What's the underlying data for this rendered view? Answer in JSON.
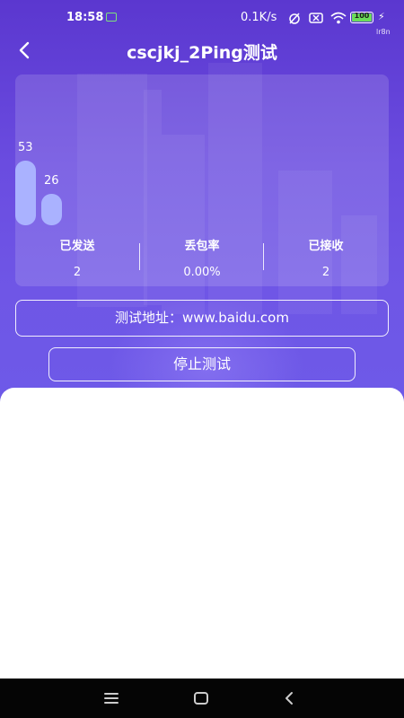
{
  "status_bar": {
    "time": "18:58",
    "net_speed": "0.1K/s",
    "battery": "100",
    "carrier_tag": "lr8n",
    "battery_level": 1.0
  },
  "header": {
    "title": "cscjkj_2Ping测试",
    "back_icon": "chevron-left-icon"
  },
  "chart_data": {
    "type": "bar",
    "values": [
      53,
      26
    ],
    "categories": [
      "",
      ""
    ]
  },
  "stats": [
    {
      "label": "已发送",
      "value": "2"
    },
    {
      "label": "丢包率",
      "value": "0.00%"
    },
    {
      "label": "已接收",
      "value": "2"
    }
  ],
  "address": {
    "text": "测试地址：www.baidu.com"
  },
  "stop_button": {
    "label": "停止测试"
  },
  "nav": {
    "menu_icon": "menu-icon",
    "home_icon": "home-icon",
    "back_icon": "back-icon"
  }
}
